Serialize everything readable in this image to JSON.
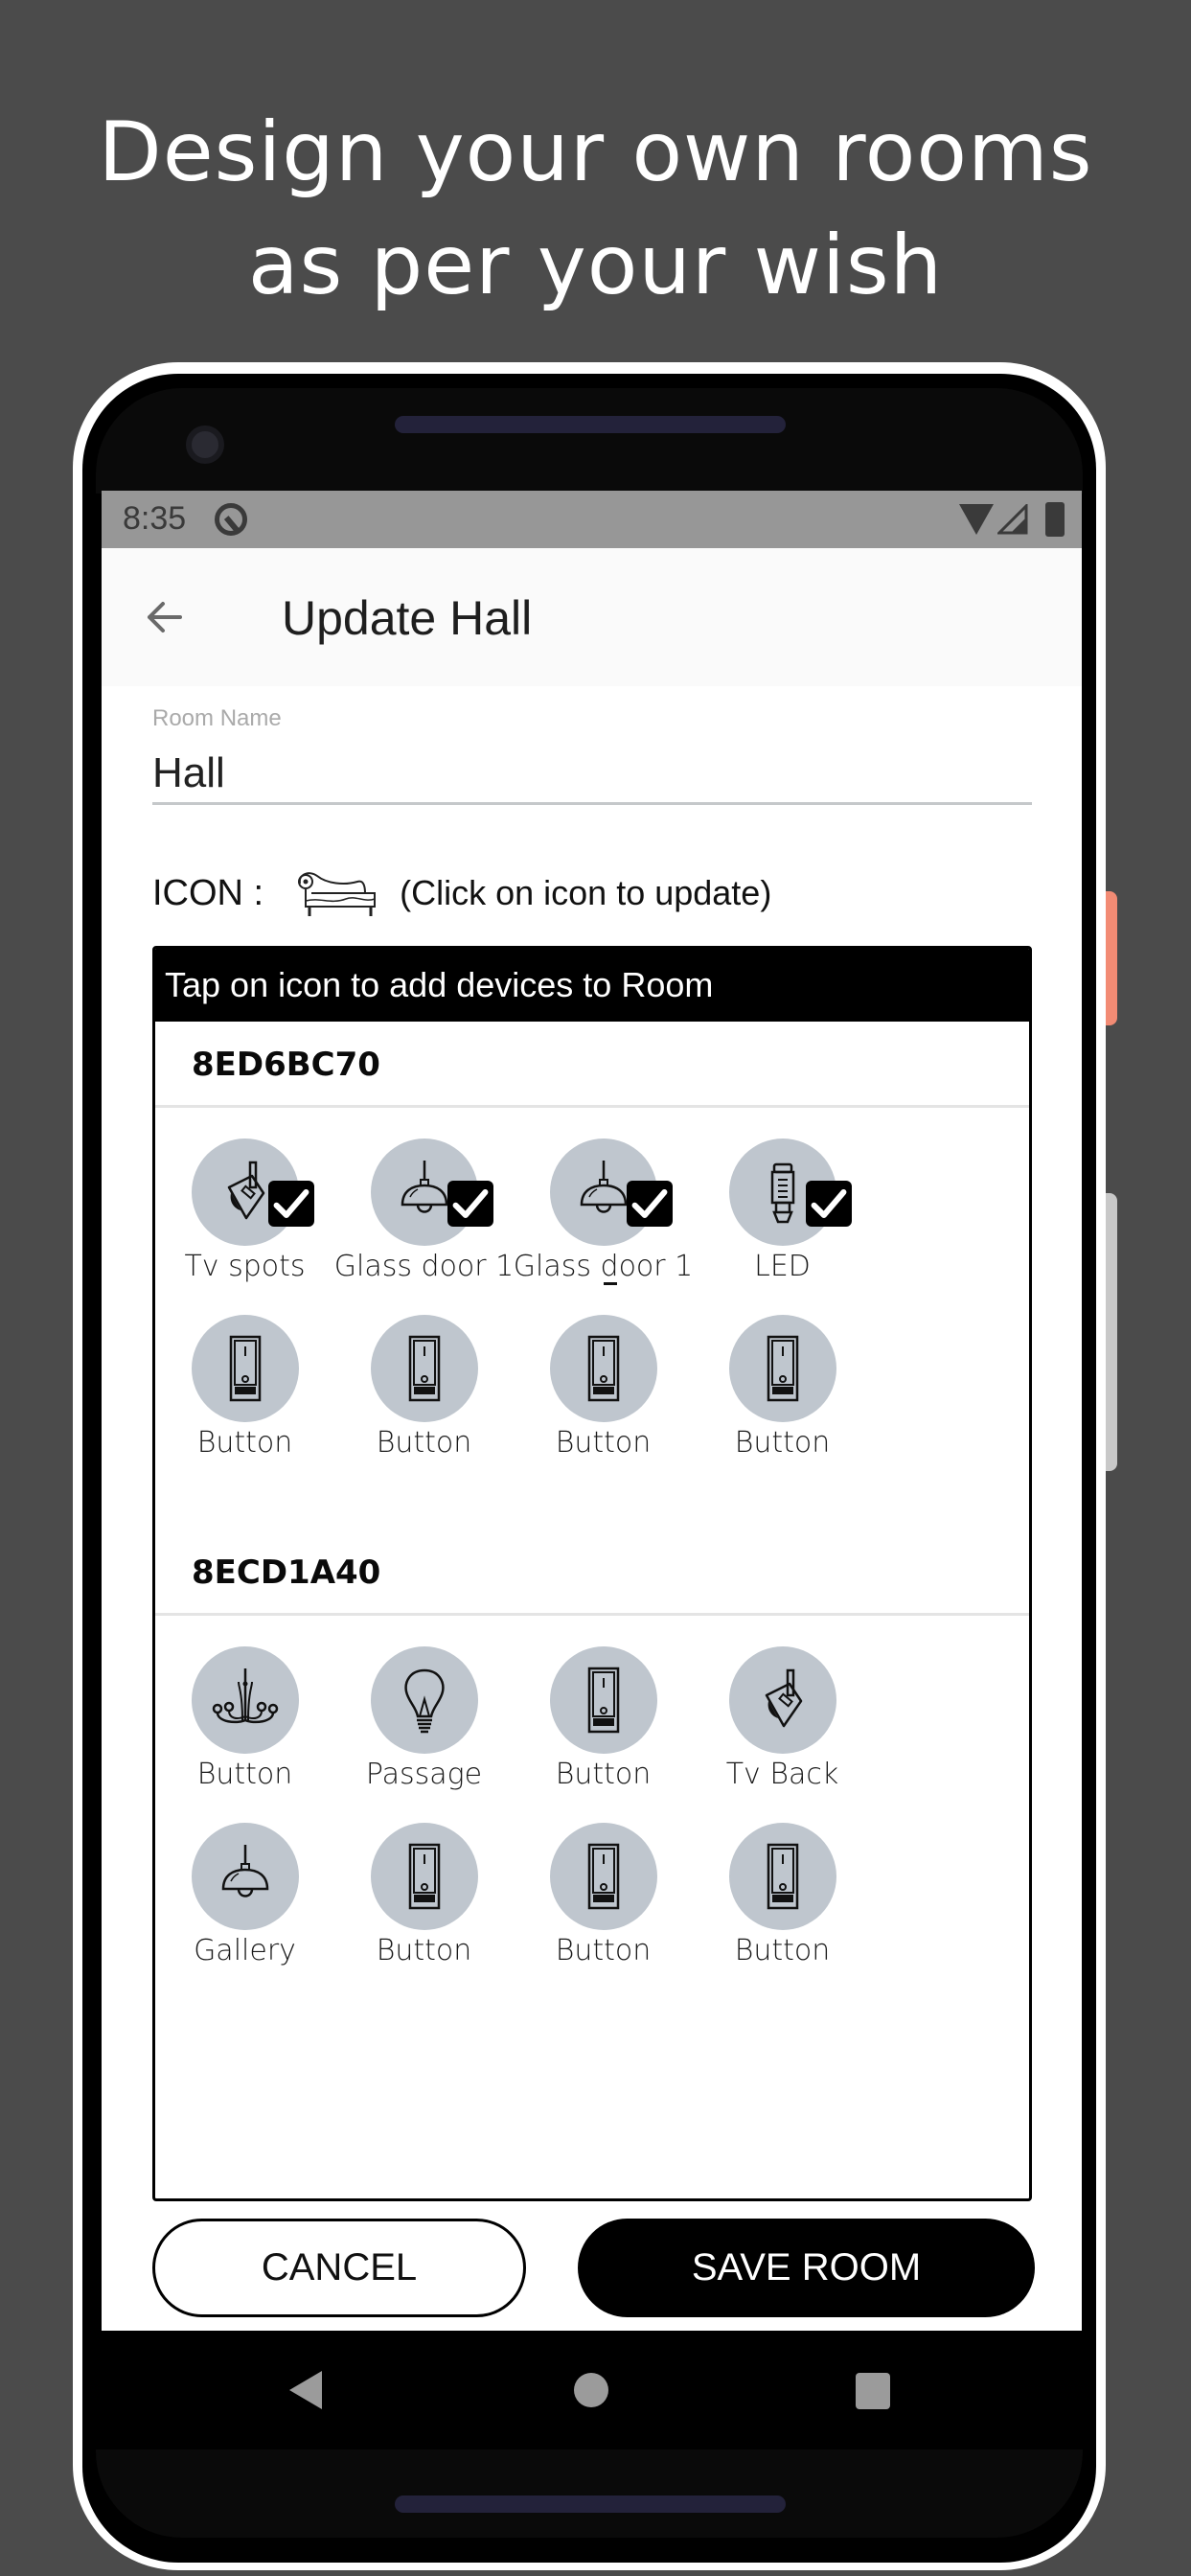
{
  "headline": {
    "line1": "Design your own rooms",
    "line2": "as per your wish"
  },
  "status_bar": {
    "time": "8:35",
    "icons": [
      "dnd-q-icon",
      "wifi-icon",
      "signal-icon",
      "battery-icon"
    ]
  },
  "app_bar": {
    "back_icon": "arrow-left-icon",
    "title": "Update Hall"
  },
  "room_name_field": {
    "label": "Room Name",
    "value": "Hall"
  },
  "icon_selector": {
    "label": "ICON :",
    "icon": "chaise-sofa-icon",
    "hint": "(Click on icon to update)"
  },
  "device_panel": {
    "header": "Tap on icon to add devices to Room",
    "groups": [
      {
        "id": "8ED6BC70",
        "devices": [
          {
            "name": "Tv spots",
            "icon": "spotlight-icon",
            "selected": true
          },
          {
            "name": "Glass door 1",
            "icon": "pendant-lamp-icon",
            "selected": true
          },
          {
            "name": "Glass door 1",
            "icon": "pendant-lamp-icon",
            "selected": true
          },
          {
            "name": "LED",
            "icon": "led-bulb-icon",
            "selected": true
          },
          {
            "name": "Button",
            "icon": "rocker-switch-icon",
            "selected": false
          },
          {
            "name": "Button",
            "icon": "rocker-switch-icon",
            "selected": false
          },
          {
            "name": "Button",
            "icon": "rocker-switch-icon",
            "selected": false
          },
          {
            "name": "Button",
            "icon": "rocker-switch-icon",
            "selected": false
          }
        ]
      },
      {
        "id": "8ECD1A40",
        "devices": [
          {
            "name": "Button",
            "icon": "chandelier-icon",
            "selected": false
          },
          {
            "name": "Passage",
            "icon": "light-bulb-icon",
            "selected": false
          },
          {
            "name": "Button",
            "icon": "rocker-switch-icon",
            "selected": false
          },
          {
            "name": "Tv Back",
            "icon": "spotlight-icon",
            "selected": false
          },
          {
            "name": "Gallery",
            "icon": "pendant-lamp-icon",
            "selected": false
          },
          {
            "name": "Button",
            "icon": "rocker-switch-icon",
            "selected": false
          },
          {
            "name": "Button",
            "icon": "rocker-switch-icon",
            "selected": false
          },
          {
            "name": "Button",
            "icon": "rocker-switch-icon",
            "selected": false
          }
        ]
      }
    ]
  },
  "actions": {
    "cancel": "CANCEL",
    "save": "SAVE ROOM"
  },
  "nav_bar": {
    "back": "nav-back-icon",
    "home": "nav-home-icon",
    "recents": "nav-recents-icon"
  },
  "colors": {
    "background": "#4b4b4b",
    "device_circle": "#bfc6ce",
    "status_bar": "#979797",
    "power_button": "#f28b74",
    "primary": "#000000"
  }
}
